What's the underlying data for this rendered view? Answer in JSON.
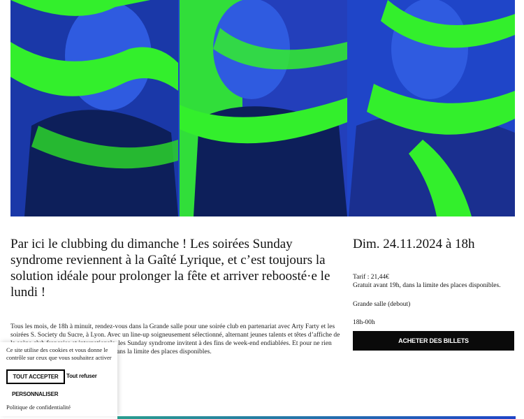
{
  "hero": {
    "alt_description": "",
    "colors": {
      "blue": "#1f45c8",
      "green": "#33ef2c",
      "dark": "#0d1f5a"
    }
  },
  "intro": {
    "text": "Par ici le clubbing du dimanche ! Les soirées Sunday syndrome reviennent à la Gaîté Lyrique, et c’est toujours la solution idéale pour prolonger la fête et arriver reboosté·e le lundi !"
  },
  "description": {
    "text": "Tous les mois, de 18h à minuit, rendez-vous dans la Grande salle pour une soirée club en partenariat avec Arty Farty et les soirées S. Society du Sucre, à Lyon. Avec un line-up soigneusement sélectionné, alternant jeunes talents et têtes d’affiche de la scène club française et internationale, les Sunday syndrome invitent à des fins de week-end endiablées. Et pour ne rien gâcher, l’entrée est gratuite avant 19h, dans la limite des places disponibles."
  },
  "event": {
    "date": "Dim. 24.11.2024 à 18h",
    "tarif": "Tarif : 21,44€",
    "tarif_note": "Gratuit avant 19h, dans la limite des places disponibles.",
    "room": "Grande salle (debout)",
    "hours": "18h-00h",
    "buy_label": "ACHETER DES BILLETS"
  },
  "cookie": {
    "text": "Ce site utilise des cookies et vous donne le contrôle sur ceux que vous souhaitez activer",
    "accept_label": "TOUT ACCEPTER",
    "refuse_label": "Tout refuser",
    "customize_label": "PERSONNALISER",
    "privacy_label": "Politique de confidentialité"
  }
}
